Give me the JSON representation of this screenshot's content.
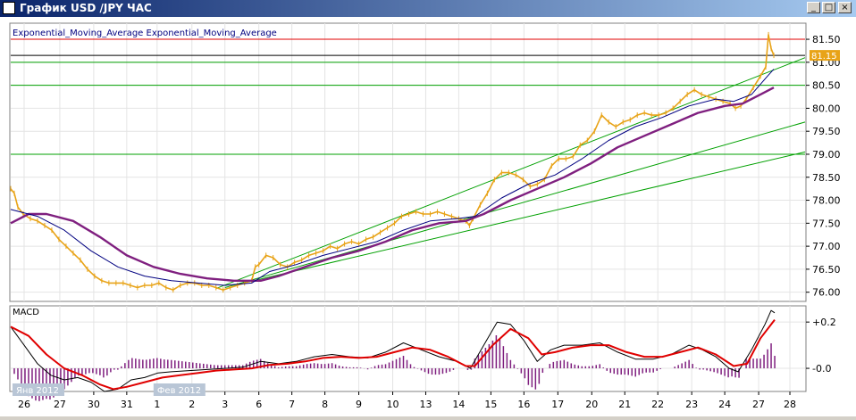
{
  "window": {
    "title": "График USD /JPY  ЧАС",
    "minimize_label": "_",
    "maximize_label": "□",
    "close_label": "×"
  },
  "colors": {
    "price": "#e8a317",
    "ema_fast": "#000080",
    "ema_slow": "#7f1f7f",
    "macd_line": "#000000",
    "signal_line": "#e00000",
    "histogram": "#7f1f7f",
    "support_lines": "#00a000",
    "resistance_line": "#e00000",
    "price_tag_bg": "#e8a317"
  },
  "chart_data": [
    {
      "type": "line",
      "legend": [
        "Exponential_Moving_Average",
        "Exponential_Moving_Average"
      ],
      "ylim": [
        75.8,
        81.85
      ],
      "yticks": [
        "81.50",
        "81.00",
        "80.50",
        "80.00",
        "79.50",
        "79.00",
        "78.50",
        "78.00",
        "77.50",
        "77.00",
        "76.50",
        "76.00"
      ],
      "current_price_label": "81.15",
      "horizontal_levels": [
        {
          "value": 81.5,
          "kind": "resistance"
        },
        {
          "value": 81.15,
          "kind": "current"
        },
        {
          "value": 81.0,
          "kind": "support"
        },
        {
          "value": 80.5,
          "kind": "support"
        },
        {
          "value": 79.0,
          "kind": "support"
        }
      ],
      "trend_lines": [
        {
          "from": [
            "Фев 2",
            76.1
          ],
          "to": [
            "27",
            81.0
          ]
        },
        {
          "from": [
            "Фев 2",
            76.1
          ],
          "to": [
            "28",
            79.7
          ]
        },
        {
          "from": [
            "Фев 3",
            76.2
          ],
          "to": [
            "28",
            79.05
          ]
        }
      ],
      "price": [
        [
          0,
          78.25
        ],
        [
          4,
          78.15
        ],
        [
          8,
          77.85
        ],
        [
          14,
          77.7
        ],
        [
          22,
          77.6
        ],
        [
          30,
          77.55
        ],
        [
          38,
          77.45
        ],
        [
          46,
          77.35
        ],
        [
          54,
          77.15
        ],
        [
          62,
          77.0
        ],
        [
          70,
          76.85
        ],
        [
          78,
          76.7
        ],
        [
          86,
          76.5
        ],
        [
          94,
          76.35
        ],
        [
          102,
          76.25
        ],
        [
          110,
          76.2
        ],
        [
          118,
          76.2
        ],
        [
          126,
          76.2
        ],
        [
          134,
          76.15
        ],
        [
          142,
          76.1
        ],
        [
          150,
          76.15
        ],
        [
          158,
          76.15
        ],
        [
          166,
          76.2
        ],
        [
          174,
          76.1
        ],
        [
          182,
          76.05
        ],
        [
          190,
          76.15
        ],
        [
          198,
          76.2
        ],
        [
          206,
          76.2
        ],
        [
          214,
          76.15
        ],
        [
          222,
          76.15
        ],
        [
          230,
          76.1
        ],
        [
          238,
          76.05
        ],
        [
          246,
          76.1
        ],
        [
          254,
          76.15
        ],
        [
          262,
          76.2
        ],
        [
          270,
          76.25
        ],
        [
          274,
          76.55
        ],
        [
          278,
          76.6
        ],
        [
          286,
          76.8
        ],
        [
          294,
          76.75
        ],
        [
          302,
          76.6
        ],
        [
          310,
          76.55
        ],
        [
          318,
          76.65
        ],
        [
          326,
          76.7
        ],
        [
          334,
          76.8
        ],
        [
          342,
          76.85
        ],
        [
          350,
          76.9
        ],
        [
          358,
          77.0
        ],
        [
          366,
          76.95
        ],
        [
          374,
          77.05
        ],
        [
          382,
          77.1
        ],
        [
          390,
          77.05
        ],
        [
          398,
          77.15
        ],
        [
          406,
          77.2
        ],
        [
          414,
          77.3
        ],
        [
          422,
          77.4
        ],
        [
          430,
          77.5
        ],
        [
          438,
          77.65
        ],
        [
          446,
          77.7
        ],
        [
          454,
          77.75
        ],
        [
          462,
          77.7
        ],
        [
          470,
          77.7
        ],
        [
          478,
          77.75
        ],
        [
          486,
          77.7
        ],
        [
          494,
          77.65
        ],
        [
          502,
          77.6
        ],
        [
          510,
          77.55
        ],
        [
          514,
          77.45
        ],
        [
          518,
          77.6
        ],
        [
          526,
          77.9
        ],
        [
          534,
          78.15
        ],
        [
          542,
          78.45
        ],
        [
          550,
          78.6
        ],
        [
          558,
          78.6
        ],
        [
          566,
          78.55
        ],
        [
          574,
          78.45
        ],
        [
          582,
          78.3
        ],
        [
          590,
          78.35
        ],
        [
          598,
          78.45
        ],
        [
          606,
          78.75
        ],
        [
          614,
          78.9
        ],
        [
          622,
          78.9
        ],
        [
          630,
          78.95
        ],
        [
          638,
          79.2
        ],
        [
          646,
          79.3
        ],
        [
          654,
          79.5
        ],
        [
          662,
          79.85
        ],
        [
          670,
          79.7
        ],
        [
          678,
          79.6
        ],
        [
          686,
          79.7
        ],
        [
          694,
          79.75
        ],
        [
          702,
          79.85
        ],
        [
          710,
          79.9
        ],
        [
          718,
          79.85
        ],
        [
          726,
          79.85
        ],
        [
          734,
          79.9
        ],
        [
          742,
          80.0
        ],
        [
          750,
          80.15
        ],
        [
          758,
          80.3
        ],
        [
          766,
          80.4
        ],
        [
          774,
          80.3
        ],
        [
          782,
          80.25
        ],
        [
          790,
          80.2
        ],
        [
          798,
          80.15
        ],
        [
          806,
          80.1
        ],
        [
          812,
          80.0
        ],
        [
          818,
          80.05
        ],
        [
          824,
          80.2
        ],
        [
          832,
          80.45
        ],
        [
          840,
          80.7
        ],
        [
          846,
          80.9
        ],
        [
          849,
          81.6
        ],
        [
          852,
          81.3
        ],
        [
          855,
          81.15
        ]
      ],
      "ema_fast": [
        [
          0,
          77.8
        ],
        [
          30,
          77.65
        ],
        [
          60,
          77.35
        ],
        [
          90,
          76.9
        ],
        [
          120,
          76.55
        ],
        [
          150,
          76.35
        ],
        [
          180,
          76.25
        ],
        [
          210,
          76.2
        ],
        [
          240,
          76.15
        ],
        [
          270,
          76.2
        ],
        [
          290,
          76.45
        ],
        [
          320,
          76.6
        ],
        [
          350,
          76.8
        ],
        [
          380,
          76.95
        ],
        [
          410,
          77.1
        ],
        [
          440,
          77.35
        ],
        [
          470,
          77.55
        ],
        [
          500,
          77.6
        ],
        [
          520,
          77.65
        ],
        [
          550,
          78.05
        ],
        [
          580,
          78.35
        ],
        [
          610,
          78.55
        ],
        [
          640,
          78.9
        ],
        [
          670,
          79.3
        ],
        [
          700,
          79.6
        ],
        [
          730,
          79.8
        ],
        [
          760,
          80.05
        ],
        [
          790,
          80.2
        ],
        [
          810,
          80.15
        ],
        [
          830,
          80.3
        ],
        [
          848,
          80.7
        ],
        [
          855,
          80.85
        ]
      ],
      "ema_slow": [
        [
          0,
          77.5
        ],
        [
          20,
          77.7
        ],
        [
          40,
          77.7
        ],
        [
          70,
          77.55
        ],
        [
          100,
          77.2
        ],
        [
          130,
          76.8
        ],
        [
          160,
          76.55
        ],
        [
          190,
          76.4
        ],
        [
          220,
          76.3
        ],
        [
          250,
          76.25
        ],
        [
          280,
          76.25
        ],
        [
          300,
          76.35
        ],
        [
          330,
          76.55
        ],
        [
          360,
          76.75
        ],
        [
          390,
          76.9
        ],
        [
          420,
          77.1
        ],
        [
          450,
          77.35
        ],
        [
          480,
          77.5
        ],
        [
          510,
          77.55
        ],
        [
          530,
          77.7
        ],
        [
          560,
          78.0
        ],
        [
          590,
          78.25
        ],
        [
          620,
          78.5
        ],
        [
          650,
          78.8
        ],
        [
          680,
          79.15
        ],
        [
          710,
          79.4
        ],
        [
          740,
          79.65
        ],
        [
          770,
          79.9
        ],
        [
          800,
          80.05
        ],
        [
          820,
          80.1
        ],
        [
          840,
          80.3
        ],
        [
          855,
          80.45
        ]
      ]
    },
    {
      "type": "line",
      "title": "MACD",
      "yticks": [
        "+0.2",
        "-0.0"
      ],
      "ylim": [
        -0.1,
        0.27
      ],
      "macd": [
        [
          0,
          0.18
        ],
        [
          15,
          0.1
        ],
        [
          30,
          0.02
        ],
        [
          45,
          -0.03
        ],
        [
          60,
          -0.05
        ],
        [
          75,
          -0.04
        ],
        [
          90,
          -0.06
        ],
        [
          105,
          -0.1
        ],
        [
          120,
          -0.09
        ],
        [
          135,
          -0.05
        ],
        [
          150,
          -0.04
        ],
        [
          165,
          -0.02
        ],
        [
          180,
          -0.015
        ],
        [
          200,
          -0.01
        ],
        [
          220,
          -0.005
        ],
        [
          240,
          0.0
        ],
        [
          260,
          0.005
        ],
        [
          280,
          0.03
        ],
        [
          300,
          0.02
        ],
        [
          320,
          0.03
        ],
        [
          340,
          0.05
        ],
        [
          360,
          0.06
        ],
        [
          380,
          0.05
        ],
        [
          400,
          0.045
        ],
        [
          420,
          0.07
        ],
        [
          440,
          0.11
        ],
        [
          460,
          0.08
        ],
        [
          480,
          0.05
        ],
        [
          500,
          0.03
        ],
        [
          515,
          0.0
        ],
        [
          530,
          0.1
        ],
        [
          545,
          0.2
        ],
        [
          560,
          0.19
        ],
        [
          575,
          0.12
        ],
        [
          590,
          0.03
        ],
        [
          605,
          0.08
        ],
        [
          620,
          0.1
        ],
        [
          640,
          0.1
        ],
        [
          660,
          0.11
        ],
        [
          680,
          0.07
        ],
        [
          700,
          0.04
        ],
        [
          720,
          0.04
        ],
        [
          740,
          0.06
        ],
        [
          760,
          0.1
        ],
        [
          775,
          0.08
        ],
        [
          790,
          0.05
        ],
        [
          805,
          0.0
        ],
        [
          815,
          -0.015
        ],
        [
          830,
          0.08
        ],
        [
          845,
          0.19
        ],
        [
          852,
          0.25
        ],
        [
          856,
          0.24
        ]
      ],
      "signal": [
        [
          0,
          0.18
        ],
        [
          20,
          0.14
        ],
        [
          40,
          0.06
        ],
        [
          60,
          0.0
        ],
        [
          80,
          -0.03
        ],
        [
          100,
          -0.07
        ],
        [
          115,
          -0.09
        ],
        [
          130,
          -0.08
        ],
        [
          150,
          -0.06
        ],
        [
          170,
          -0.04
        ],
        [
          190,
          -0.03
        ],
        [
          210,
          -0.02
        ],
        [
          230,
          -0.01
        ],
        [
          250,
          -0.005
        ],
        [
          270,
          0.0
        ],
        [
          290,
          0.015
        ],
        [
          310,
          0.02
        ],
        [
          330,
          0.03
        ],
        [
          350,
          0.045
        ],
        [
          370,
          0.05
        ],
        [
          390,
          0.045
        ],
        [
          410,
          0.05
        ],
        [
          430,
          0.07
        ],
        [
          450,
          0.09
        ],
        [
          470,
          0.08
        ],
        [
          490,
          0.05
        ],
        [
          510,
          0.01
        ],
        [
          520,
          0.01
        ],
        [
          540,
          0.1
        ],
        [
          560,
          0.17
        ],
        [
          580,
          0.13
        ],
        [
          595,
          0.06
        ],
        [
          610,
          0.07
        ],
        [
          630,
          0.09
        ],
        [
          650,
          0.1
        ],
        [
          670,
          0.1
        ],
        [
          690,
          0.07
        ],
        [
          710,
          0.05
        ],
        [
          730,
          0.05
        ],
        [
          750,
          0.07
        ],
        [
          770,
          0.09
        ],
        [
          790,
          0.06
        ],
        [
          810,
          0.01
        ],
        [
          825,
          0.02
        ],
        [
          840,
          0.13
        ],
        [
          856,
          0.21
        ]
      ],
      "histogram_note": "purple bars around zero line"
    }
  ],
  "xaxis": {
    "ticks": [
      {
        "label": "26",
        "i": 15
      },
      {
        "label": "27",
        "i": 55
      },
      {
        "label": "30",
        "i": 93
      },
      {
        "label": "31",
        "i": 130
      },
      {
        "label": "1",
        "i": 164
      },
      {
        "label": "2",
        "i": 203
      },
      {
        "label": "3",
        "i": 240
      },
      {
        "label": "6",
        "i": 278
      },
      {
        "label": "7",
        "i": 315
      },
      {
        "label": "8",
        "i": 352
      },
      {
        "label": "9",
        "i": 390
      },
      {
        "label": "10",
        "i": 428
      },
      {
        "label": "13",
        "i": 465
      },
      {
        "label": "14",
        "i": 502
      },
      {
        "label": "15",
        "i": 538
      },
      {
        "label": "16",
        "i": 575
      },
      {
        "label": "17",
        "i": 613
      },
      {
        "label": "20",
        "i": 651
      },
      {
        "label": "21",
        "i": 688
      },
      {
        "label": "22",
        "i": 725
      },
      {
        "label": "23",
        "i": 763
      },
      {
        "label": "24",
        "i": 800
      },
      {
        "label": "27",
        "i": 838
      },
      {
        "label": "28",
        "i": 873
      }
    ],
    "month_labels": [
      {
        "label": "Янв 2012",
        "i": 2
      },
      {
        "label": "Фев 2012",
        "i": 160
      }
    ]
  }
}
